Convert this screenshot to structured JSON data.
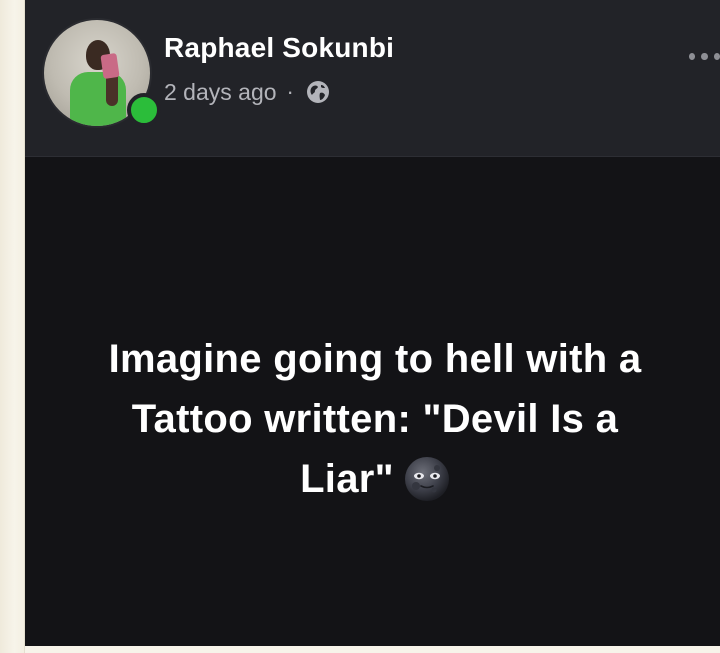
{
  "post": {
    "author": {
      "name": "Raphael Sokunbi",
      "avatar_icon": "profile-photo",
      "online": true
    },
    "timestamp": "2 days ago",
    "separator": "·",
    "privacy_icon": "globe-icon",
    "more_icon": "more-dots-icon",
    "body": {
      "line1": "Imagine going to hell with a",
      "line2": "Tattoo written: \"Devil Is a",
      "line3": "Liar\"",
      "emoji": "new-moon-face-emoji"
    }
  },
  "colors": {
    "header_bg": "#222328",
    "body_bg": "#131316",
    "text": "#ffffff",
    "meta_text": "#b3b4ba",
    "online_green": "#2bbd3a"
  }
}
